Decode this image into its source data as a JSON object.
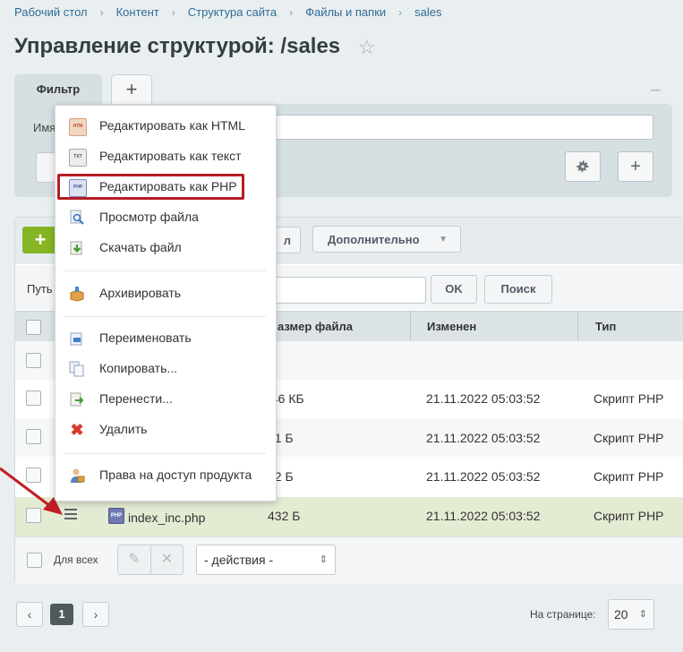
{
  "breadcrumbs": [
    "Рабочий стол",
    "Контент",
    "Структура сайта",
    "Файлы и папки",
    "sales"
  ],
  "page_title": "Управление структурой: /sales",
  "filter": {
    "tab_label": "Фильтр",
    "add_tab": "+",
    "collapse": "−",
    "field_label": "Имя",
    "name_value": "",
    "settings_icon": "gear-icon",
    "add_button": "+"
  },
  "toolbar": {
    "add": "+",
    "partial_button": "л",
    "more_button": "Дополнительно"
  },
  "path": {
    "label": "Путь",
    "value": "",
    "ok_button": "OK",
    "search_button": "Поиск"
  },
  "table": {
    "columns": [
      "азмер файла",
      "Изменен",
      "Тип"
    ],
    "rows": [
      {
        "name": "",
        "size": "",
        "changed": "",
        "type": ""
      },
      {
        "name": "",
        "size": ".46 КБ",
        "changed": "21.11.2022 05:03:52",
        "type": "Скрипт PHP"
      },
      {
        "name": "",
        "size": "01 Б",
        "changed": "21.11.2022 05:03:52",
        "type": "Скрипт PHP"
      },
      {
        "name": "",
        "size": "52 Б",
        "changed": "21.11.2022 05:03:52",
        "type": "Скрипт PHP"
      },
      {
        "name": "index_inc.php",
        "size": "432 Б",
        "changed": "21.11.2022 05:03:52",
        "type": "Скрипт PHP"
      }
    ]
  },
  "footer": {
    "for_all": "Для всех",
    "actions": "- действия -"
  },
  "pagination": {
    "prev": "‹",
    "current": "1",
    "next": "›",
    "per_page_label": "На странице:",
    "per_page": "20"
  },
  "context_menu": {
    "items": [
      "Редактировать как HTML",
      "Редактировать как текст",
      "Редактировать как PHP",
      "Просмотр файла",
      "Скачать файл",
      "Архивировать",
      "Переименовать",
      "Копировать...",
      "Перенести...",
      "Удалить",
      "Права на доступ продукта"
    ]
  },
  "colors": {
    "accent_green": "#86b523",
    "highlight_red": "#b61c23",
    "link_blue": "#2f6c95",
    "selected_row": "#e4ebd3"
  }
}
